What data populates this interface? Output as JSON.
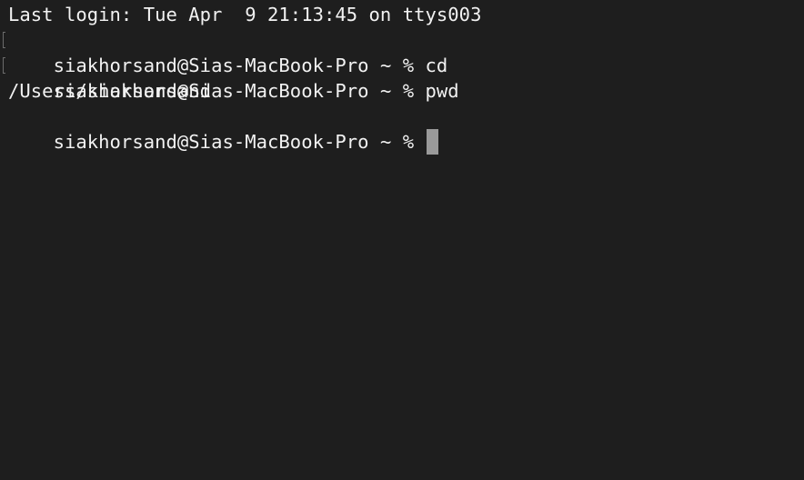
{
  "terminal": {
    "login_message": "Last login: Tue Apr  9 21:13:45 on ttys003",
    "lines": [
      {
        "prompt": "siakhorsand@Sias-MacBook-Pro ~ % ",
        "command": "cd"
      },
      {
        "prompt": "siakhorsand@Sias-MacBook-Pro ~ % ",
        "command": "pwd"
      }
    ],
    "output": "/Users/siakhorsand",
    "current_prompt": "siakhorsand@Sias-MacBook-Pro ~ % ",
    "colors": {
      "background": "#1e1e1e",
      "foreground": "#f2f2f2",
      "cursor": "#9a9a9a"
    }
  }
}
